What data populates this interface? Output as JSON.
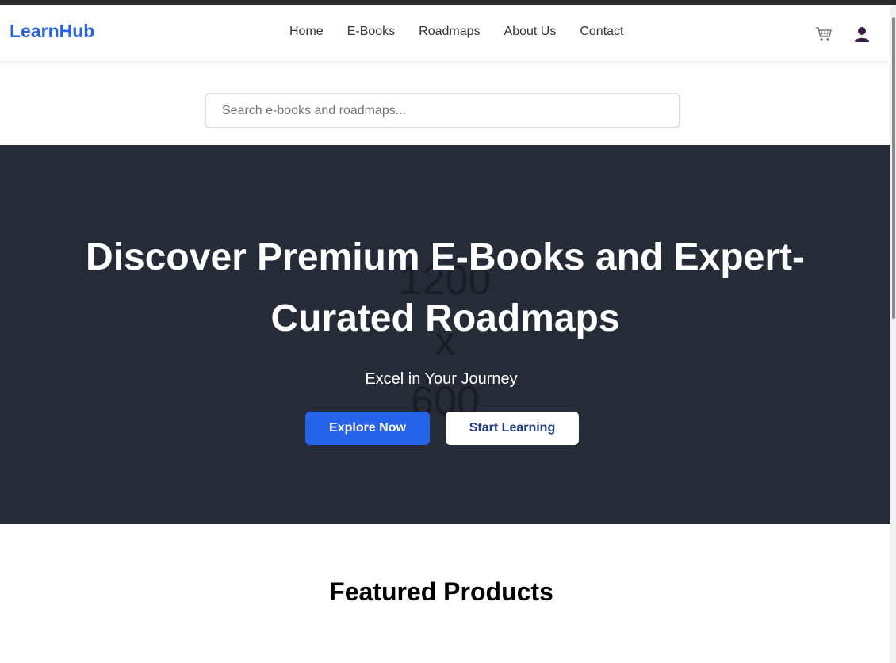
{
  "header": {
    "logo": "LearnHub",
    "nav": [
      "Home",
      "E-Books",
      "Roadmaps",
      "About Us",
      "Contact"
    ],
    "icons": [
      "cart-icon",
      "user-icon"
    ]
  },
  "search": {
    "placeholder": "Search e-books and roadmaps...",
    "value": ""
  },
  "hero": {
    "placeholder_lines": [
      "1200",
      "x",
      "600"
    ],
    "title": "Discover Premium E-Books and Expert-Curated Roadmaps",
    "subtitle": "Excel in Your Journey",
    "primary_button": "Explore Now",
    "secondary_button": "Start Learning"
  },
  "featured": {
    "title": "Featured Products"
  },
  "colors": {
    "brand": "#2563eb",
    "hero_bg": "#262b38",
    "secondary_button_text": "#1e3a8a"
  }
}
